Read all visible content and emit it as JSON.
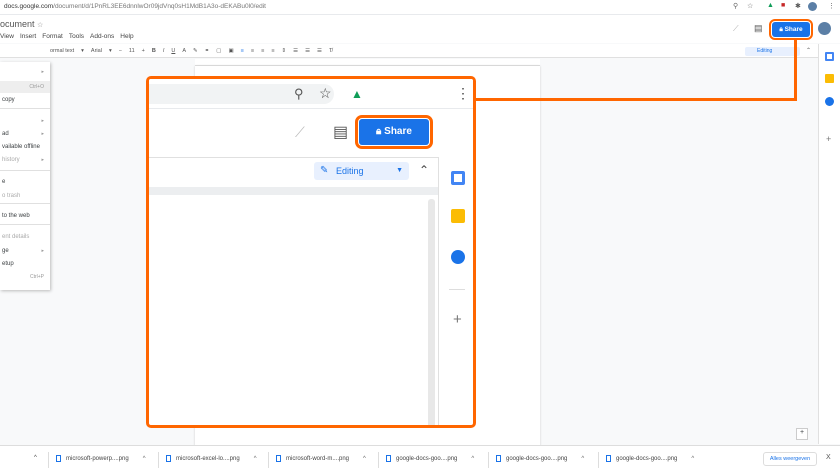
{
  "browser": {
    "url_host": "docs.google.com",
    "url_path": "/document/d/1PnRL3EE6dnnlwOr09jdVnq0sH1MdB1A3o-dEKABu0l0/edit"
  },
  "doc": {
    "title": "ocument",
    "menu": [
      "View",
      "Insert",
      "Format",
      "Tools",
      "Add-ons",
      "Help"
    ]
  },
  "toolbar": {
    "style": "ormal text",
    "font": "Arial",
    "size": "11",
    "items": [
      "B",
      "I",
      "U",
      "A"
    ]
  },
  "left_menu": [
    {
      "label": "",
      "right": "▸",
      "state": "normal"
    },
    {
      "label": "",
      "right": "Ctrl+O",
      "state": "highlighted"
    },
    {
      "label": "copy",
      "right": "",
      "state": "normal"
    },
    {
      "label": "",
      "right": "▸",
      "state": "normal"
    },
    {
      "label": "ad",
      "right": "▸",
      "state": "normal"
    },
    {
      "label": "vailable offline",
      "right": "",
      "state": "normal"
    },
    {
      "label": "history",
      "right": "▸",
      "state": "disabled"
    },
    {
      "label": "e",
      "right": "",
      "state": "normal"
    },
    {
      "label": "o trash",
      "right": "",
      "state": "disabled"
    },
    {
      "label": "to the web",
      "right": "",
      "state": "normal"
    },
    {
      "label": "ent details",
      "right": "",
      "state": "disabled"
    },
    {
      "label": "ge",
      "right": "▸",
      "state": "normal"
    },
    {
      "label": "etup",
      "right": "",
      "state": "normal"
    },
    {
      "label": "",
      "right": "Ctrl+P",
      "state": "normal"
    }
  ],
  "share_label": "Share",
  "editing_label": "Editing",
  "callout": {
    "share_label": "Share",
    "editing_label": "Editing"
  },
  "downloads": {
    "items": [
      "microsoft-powerp....png",
      "microsoft-excel-lo....png",
      "microsoft-word-m....png",
      "google-docs-goo....png",
      "google-docs-goo....png",
      "google-docs-goo....png"
    ],
    "show_all": "Alles weergeven",
    "close": "X"
  },
  "colors": {
    "accent": "#1a73e8",
    "highlight": "#ff6600"
  }
}
